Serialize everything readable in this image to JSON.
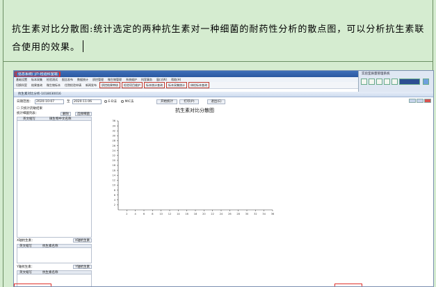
{
  "document": {
    "paragraph": "抗生素对比分散图:统计选定的两种抗生素对一种细菌的耐药性分析的散点图，可以分析抗生素联合使用的效果。"
  },
  "app": {
    "title": "信息系统门户-检验科室端",
    "right_panel_title": "实验室质量管理系统",
    "menu": [
      "基础设置",
      "标本采集",
      "检验测试",
      "报告发布",
      "数据统计",
      "质控管理",
      "微生物管理",
      "系统维护",
      "科室事务",
      "窗口(W)",
      "帮助(H)"
    ],
    "toolbar": [
      "切换科室",
      "结果查询",
      "微生物标本",
      "住院检验申请",
      "新闻发布",
      "质控结果审核",
      "检验项目维护",
      "标本统计查询",
      "标本采集统计",
      "体检标本查询"
    ],
    "inner_window_title": "抗生素对比分析-1018030016"
  },
  "filters": {
    "period_label": "日期范围：",
    "start_date": "2020-10-07",
    "to_label": "至",
    "end_date": "2020-11-06",
    "radio_1": "E-D法",
    "radio_2": "MIC法",
    "stats_button": "开始统计",
    "print_button": "打印(P)",
    "exit_button": "退出(E)"
  },
  "left_panel": {
    "checkbox_label": "只统计药敏结果",
    "list_label": "统计细菌列表：",
    "delete_button": "删除",
    "select_button": "选择细菌",
    "bacteria_headers": [
      "英文缩写",
      "微生物中文名称"
    ],
    "x_drug_label": "X轴抗生素：",
    "x_drug_button": "X轴抗生素",
    "y_drug_label": "Y轴抗生素：",
    "y_drug_button": "Y轴抗生素",
    "drug_headers": [
      "英文缩写",
      "抗生素名称"
    ]
  },
  "chart_data": {
    "type": "scatter",
    "title": "抗生素对比分散图",
    "x_ticks": [
      0,
      2,
      4,
      6,
      8,
      10,
      12,
      14,
      16,
      18,
      20,
      22,
      24,
      26,
      28,
      30,
      32,
      34,
      36
    ],
    "y_ticks": [
      0,
      2,
      4,
      6,
      8,
      10,
      12,
      14,
      16,
      18,
      20,
      22,
      24,
      26,
      28,
      30,
      32,
      34,
      36
    ],
    "xlim": [
      0,
      36
    ],
    "ylim": [
      0,
      36
    ],
    "points": [],
    "grid": false
  },
  "colors": {
    "document_bg": "#d5ecd0",
    "highlight": "#e0302a",
    "titlebar": "#3f6fb8"
  }
}
